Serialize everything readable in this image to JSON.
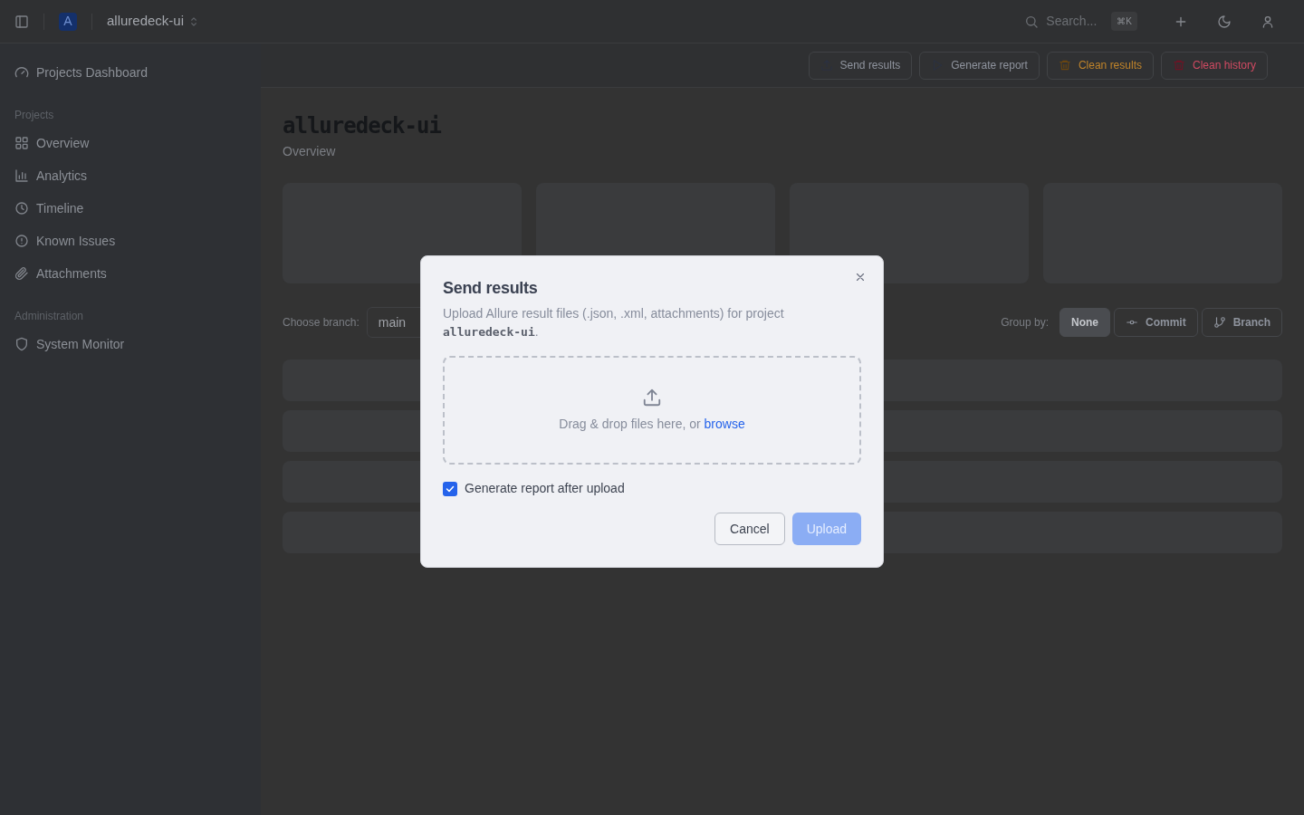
{
  "topbar": {
    "logo_letter": "A",
    "project": "alluredeck-ui",
    "search": {
      "placeholder": "Search...",
      "shortcut": "⌘K"
    }
  },
  "sidebar": {
    "top_item": "Projects Dashboard",
    "sections": [
      {
        "label": "Projects",
        "items": [
          {
            "label": "Overview"
          },
          {
            "label": "Analytics"
          },
          {
            "label": "Timeline"
          },
          {
            "label": "Known Issues"
          },
          {
            "label": "Attachments"
          }
        ]
      },
      {
        "label": "Administration",
        "items": [
          {
            "label": "System Monitor"
          }
        ]
      }
    ]
  },
  "toolbar": [
    {
      "label": "Send results",
      "kind": "default"
    },
    {
      "label": "Generate report",
      "kind": "default"
    },
    {
      "label": "Clean results",
      "kind": "warning"
    },
    {
      "label": "Clean history",
      "kind": "danger"
    }
  ],
  "page": {
    "title": "alluredeck-ui",
    "subtitle": "Overview",
    "branch": {
      "label": "Choose branch:",
      "value": "main"
    },
    "group_by": {
      "label": "Group by:",
      "options": [
        {
          "label": "None",
          "selected": true
        },
        {
          "label": "Commit",
          "selected": false
        },
        {
          "label": "Branch",
          "selected": false
        }
      ]
    }
  },
  "dialog": {
    "title": "Send results",
    "description": "Upload Allure result files (.json, .xml, attachments) for project",
    "project": "alluredeck-ui",
    "description_end": ".",
    "dropzone": {
      "text": "Drag & drop files here, or",
      "link": "browse"
    },
    "option": {
      "label": "Generate report after upload",
      "checked": true
    },
    "buttons": [
      {
        "label": "Cancel",
        "kind": "secondary",
        "disabled": false
      },
      {
        "label": "Upload",
        "kind": "primary",
        "disabled": true
      }
    ]
  }
}
